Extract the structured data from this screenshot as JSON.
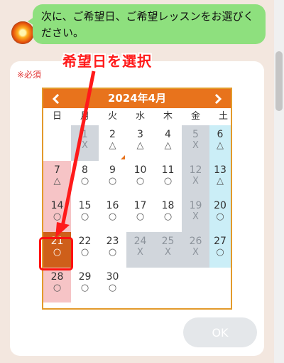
{
  "chat": {
    "message": "次に、ご希望日、ご希望レッスンをお選びください。"
  },
  "form": {
    "required_label": "※必須",
    "ok_label": "OK"
  },
  "calendar": {
    "title": "2024年4月",
    "weekdays": [
      "日",
      "月",
      "火",
      "水",
      "木",
      "金",
      "土"
    ],
    "days": {
      "d1": {
        "num": "1",
        "mark": "X"
      },
      "d2": {
        "num": "2",
        "mark": "△"
      },
      "d3": {
        "num": "3",
        "mark": "△"
      },
      "d4": {
        "num": "4",
        "mark": "△"
      },
      "d5": {
        "num": "5",
        "mark": "X"
      },
      "d6": {
        "num": "6",
        "mark": "△"
      },
      "d7": {
        "num": "7",
        "mark": "△"
      },
      "d8": {
        "num": "8",
        "mark": "○"
      },
      "d9": {
        "num": "9",
        "mark": "○"
      },
      "d10": {
        "num": "10",
        "mark": "○"
      },
      "d11": {
        "num": "11",
        "mark": "○"
      },
      "d12": {
        "num": "12",
        "mark": "X"
      },
      "d13": {
        "num": "13",
        "mark": "△"
      },
      "d14": {
        "num": "14",
        "mark": "○"
      },
      "d15": {
        "num": "15",
        "mark": "○"
      },
      "d16": {
        "num": "16",
        "mark": "○"
      },
      "d17": {
        "num": "17",
        "mark": "○"
      },
      "d18": {
        "num": "18",
        "mark": "○"
      },
      "d19": {
        "num": "19",
        "mark": "X"
      },
      "d20": {
        "num": "20",
        "mark": "○"
      },
      "d21": {
        "num": "21",
        "mark": "○"
      },
      "d22": {
        "num": "22",
        "mark": "○"
      },
      "d23": {
        "num": "23",
        "mark": "○"
      },
      "d24": {
        "num": "24",
        "mark": "X"
      },
      "d25": {
        "num": "25",
        "mark": "X"
      },
      "d26": {
        "num": "26",
        "mark": "X"
      },
      "d27": {
        "num": "27",
        "mark": "○"
      },
      "d28": {
        "num": "28",
        "mark": "○"
      },
      "d29": {
        "num": "29",
        "mark": "○"
      },
      "d30": {
        "num": "30",
        "mark": "○"
      }
    }
  },
  "annotation": {
    "text": "希望日を選択",
    "color": "#ff1a1a"
  },
  "colors": {
    "header": "#e8731c",
    "selected": "#ce5f1a",
    "bubble": "#8ee07e"
  }
}
